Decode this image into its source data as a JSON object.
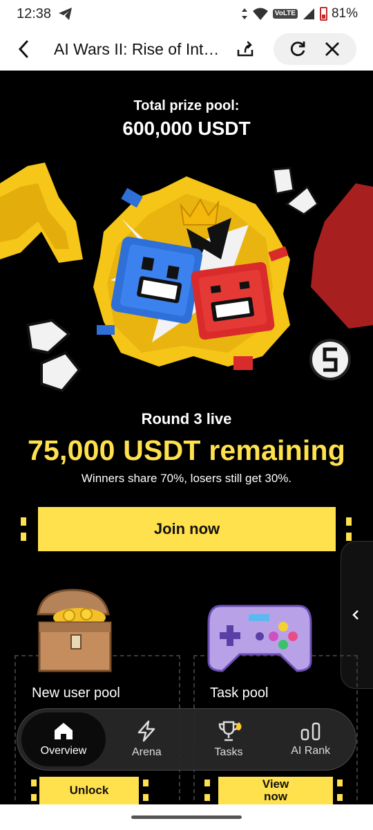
{
  "status": {
    "time": "12:38",
    "network": "VoLTE",
    "battery": "81%"
  },
  "browser": {
    "title": "AI Wars II: Rise of Int…"
  },
  "hero": {
    "prize_label": "Total prize pool:",
    "prize_value": "600,000 USDT",
    "round": "Round 3 live",
    "remaining": "75,000 USDT remaining",
    "subtitle": "Winners share 70%, losers still get 30%.",
    "join_label": "Join now"
  },
  "pools": [
    {
      "title": "New user pool",
      "button": "Unlock"
    },
    {
      "title": "Task pool",
      "button": "View now"
    }
  ],
  "nav": [
    {
      "label": "Overview",
      "icon": "home-icon",
      "active": true
    },
    {
      "label": "Arena",
      "icon": "lightning-icon",
      "active": false
    },
    {
      "label": "Tasks",
      "icon": "trophy-icon",
      "active": false
    },
    {
      "label": "AI Rank",
      "icon": "rank-bars-icon",
      "active": false
    }
  ],
  "colors": {
    "accent": "#ffe14d",
    "background": "#000000",
    "nav_bg": "#282828",
    "red_block": "#d92b2b",
    "blue_block": "#2f6fd8"
  }
}
